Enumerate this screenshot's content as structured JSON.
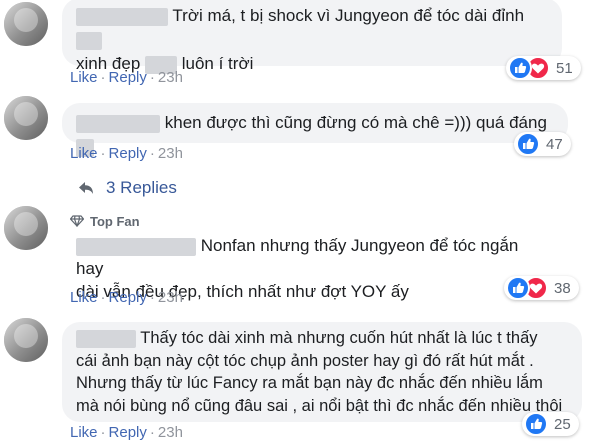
{
  "comments": [
    {
      "line1": "Trời má, t bị shock vì Jungyeon để tóc dài đỉnh",
      "line2a": "xinh đẹp",
      "line2b": "luôn í trời",
      "actions": {
        "like": "Like",
        "reply": "Reply",
        "time": "23h"
      },
      "reactions": {
        "count": "51",
        "types": [
          "like-icon",
          "love-icon"
        ]
      }
    },
    {
      "line1": "khen được thì cũng đừng có mà chê =))) quá đáng",
      "actions": {
        "like": "Like",
        "reply": "Reply",
        "time": "23h"
      },
      "reactions": {
        "count": "47",
        "types": [
          "like-icon"
        ]
      }
    },
    {
      "badge": "Top Fan",
      "line1": "Nonfan nhưng thấy Jungyeon để tóc ngắn hay",
      "line2": "dài vẫn đều đẹp, thích nhất như đợt YOY ấy",
      "actions": {
        "like": "Like",
        "reply": "Reply",
        "time": "23h"
      },
      "reactions": {
        "count": "38",
        "types": [
          "like-icon",
          "love-icon"
        ]
      }
    },
    {
      "line1": "Thấy tóc dài xinh mà nhưng cuốn hút nhất là lúc t thấy",
      "line2": "cái ảnh bạn này cột tóc chụp ảnh poster hay gì đó rất hút mắt .",
      "line3": "Nhưng thấy từ lúc Fancy ra mắt bạn này đc nhắc đến nhiều lắm",
      "line4": "mà nói bùng nổ cũng đâu sai , ai nổi bật thì đc nhắc đến nhiều thôi",
      "actions": {
        "like": "Like",
        "reply": "Reply",
        "time": "23h"
      },
      "reactions": {
        "count": "25",
        "types": [
          "like-icon"
        ]
      }
    }
  ],
  "replies_link": "3 Replies",
  "colors": {
    "link": "#4267b2",
    "bubble": "#f2f3f5",
    "meta": "#90949c",
    "like": "#2078f4",
    "love": "#f0284a"
  }
}
